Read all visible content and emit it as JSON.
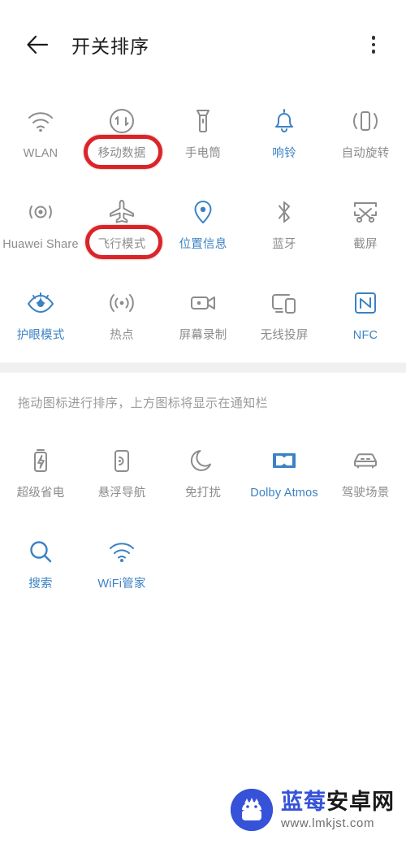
{
  "header": {
    "back_icon": "arrow-left-icon",
    "title": "开关排序",
    "overflow_icon": "more-vertical-icon"
  },
  "colors": {
    "accent_blue": "#3b82c4",
    "inactive_gray": "#8c8c8c",
    "annotation_red": "#d9252a",
    "band_gray": "#f0f0f0",
    "watermark_blue": "#3552d8"
  },
  "top_grid": {
    "tiles": [
      {
        "label": "WLAN",
        "icon": "wifi-icon",
        "active": false,
        "highlighted": false
      },
      {
        "label": "移动数据",
        "icon": "mobile-data-icon",
        "active": false,
        "highlighted": true
      },
      {
        "label": "手电筒",
        "icon": "flashlight-icon",
        "active": false,
        "highlighted": false
      },
      {
        "label": "响铃",
        "icon": "bell-icon",
        "active": true,
        "highlighted": false
      },
      {
        "label": "自动旋转",
        "icon": "auto-rotate-icon",
        "active": false,
        "highlighted": false
      },
      {
        "label": "Huawei Share",
        "icon": "huawei-share-icon",
        "active": false,
        "highlighted": false
      },
      {
        "label": "飞行模式",
        "icon": "airplane-icon",
        "active": false,
        "highlighted": true
      },
      {
        "label": "位置信息",
        "icon": "location-pin-icon",
        "active": true,
        "highlighted": false
      },
      {
        "label": "蓝牙",
        "icon": "bluetooth-icon",
        "active": false,
        "highlighted": false
      },
      {
        "label": "截屏",
        "icon": "screenshot-icon",
        "active": false,
        "highlighted": false
      },
      {
        "label": "护眼模式",
        "icon": "eye-comfort-icon",
        "active": true,
        "highlighted": false
      },
      {
        "label": "热点",
        "icon": "hotspot-icon",
        "active": false,
        "highlighted": false
      },
      {
        "label": "屏幕录制",
        "icon": "screen-record-icon",
        "active": false,
        "highlighted": false
      },
      {
        "label": "无线投屏",
        "icon": "cast-screen-icon",
        "active": false,
        "highlighted": false
      },
      {
        "label": "NFC",
        "icon": "nfc-icon",
        "active": true,
        "highlighted": false
      }
    ]
  },
  "hint": "拖动图标进行排序，上方图标将显示在通知栏",
  "bottom_grid": {
    "tiles": [
      {
        "label": "超级省电",
        "icon": "battery-saver-icon",
        "active": false
      },
      {
        "label": "悬浮导航",
        "icon": "floating-nav-icon",
        "active": false
      },
      {
        "label": "免打扰",
        "icon": "do-not-disturb-icon",
        "active": false
      },
      {
        "label": "Dolby Atmos",
        "icon": "dolby-atmos-icon",
        "active": true
      },
      {
        "label": "驾驶场景",
        "icon": "driving-mode-icon",
        "active": false
      },
      {
        "label": "搜索",
        "icon": "search-icon",
        "active": true
      },
      {
        "label": "WiFi管家",
        "icon": "wifi-manager-icon",
        "active": true
      }
    ]
  },
  "watermark": {
    "logo_icon": "blueberry-android-logo",
    "brand_blue": "蓝莓",
    "brand_dark": "安卓网",
    "url": "www.lmkjst.com"
  }
}
